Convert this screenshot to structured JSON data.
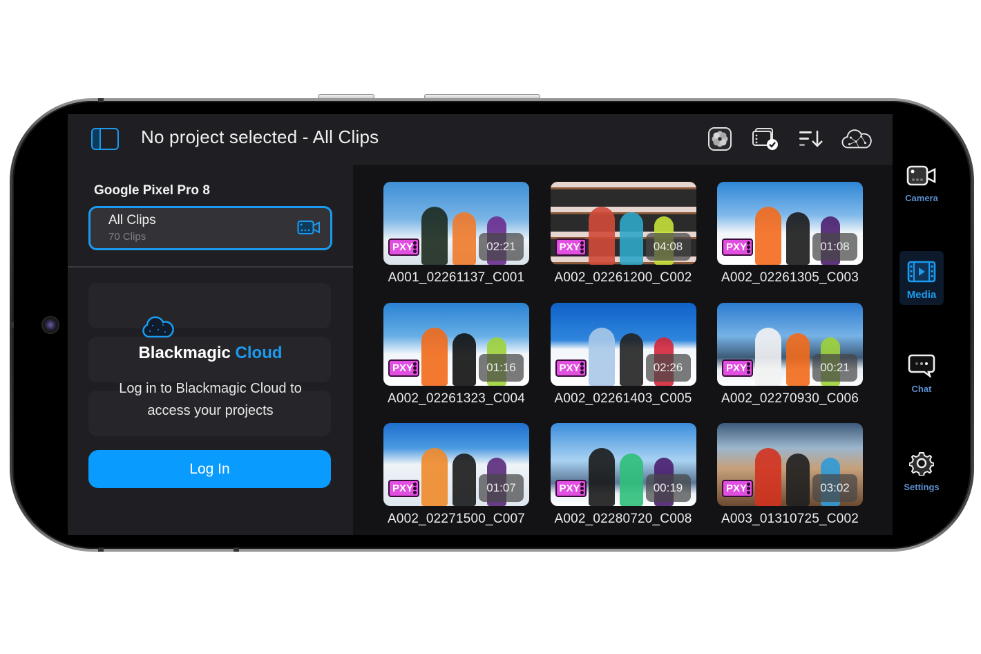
{
  "topbar": {
    "title": "No project selected - All Clips",
    "icons": [
      "photos-icon",
      "media-check-icon",
      "sort-icon",
      "cloud-network-icon"
    ]
  },
  "leftpanel": {
    "device_name": "Google Pixel Pro 8",
    "all_clips": {
      "label": "All Clips",
      "count": "70 Clips"
    },
    "cloud": {
      "brand_primary": "Blackmagic",
      "brand_accent": "Cloud",
      "message": "Log in to Blackmagic Cloud to access your projects",
      "login_label": "Log In"
    }
  },
  "clips": [
    {
      "name": "A001_02261137_C001",
      "duration": "02:21",
      "badge": "PXY",
      "scene": "group-forest"
    },
    {
      "name": "A002_02261200_C002",
      "duration": "04:08",
      "badge": "PXY",
      "scene": "helmet-shelves"
    },
    {
      "name": "A002_02261305_C003",
      "duration": "01:08",
      "badge": "PXY",
      "scene": "couple-snow"
    },
    {
      "name": "A002_02261323_C004",
      "duration": "01:16",
      "badge": "PXY",
      "scene": "goggles-snowboard"
    },
    {
      "name": "A002_02261403_C005",
      "duration": "02:26",
      "badge": "PXY",
      "scene": "skier-slope"
    },
    {
      "name": "A002_02270930_C006",
      "duration": "00:21",
      "badge": "PXY",
      "scene": "smiling-jacket"
    },
    {
      "name": "A002_02271500_C007",
      "duration": "01:07",
      "badge": "PXY",
      "scene": "friends-laughing"
    },
    {
      "name": "A002_02280720_C008",
      "duration": "00:19",
      "badge": "PXY",
      "scene": "snowboarder-standing"
    },
    {
      "name": "A003_01310725_C002",
      "duration": "03:02",
      "badge": "PXY",
      "scene": "lounge-deck"
    }
  ],
  "nav": [
    {
      "label": "Camera",
      "icon": "camera-icon",
      "active": false
    },
    {
      "label": "Media",
      "icon": "media-icon",
      "active": true
    },
    {
      "label": "Chat",
      "icon": "chat-icon",
      "active": false
    },
    {
      "label": "Settings",
      "icon": "settings-icon",
      "active": false
    }
  ],
  "colors": {
    "accent": "#1b9bf0",
    "login_button": "#0a9bff",
    "proxy_badge": "#e14fe0",
    "panel_bg": "#1f1f23",
    "grid_bg": "#131316"
  }
}
